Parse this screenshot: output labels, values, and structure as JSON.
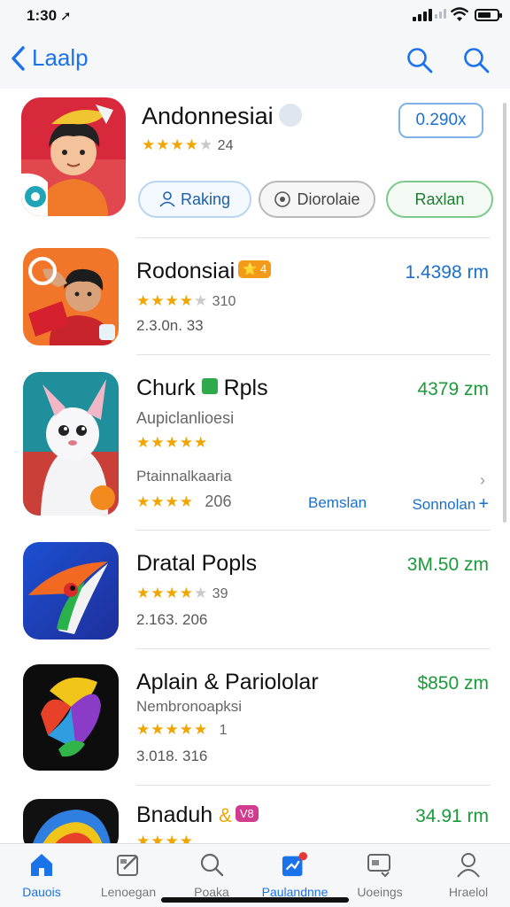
{
  "status_bar": {
    "time": "1:30",
    "location_glyph": "➚"
  },
  "nav": {
    "back_label": "Laalp"
  },
  "featured": {
    "title": "Andonnesiai",
    "rating_count": "24",
    "price": "0.290x",
    "buttons": [
      "Raking",
      "Diorolaie",
      "Raxlan"
    ]
  },
  "apps": [
    {
      "name": "Rodonsiai",
      "tag": "⭐ 4",
      "rating": "310",
      "meta": "2.3.0n. 33",
      "price": "1.4398 rm",
      "price_color": "blue"
    },
    {
      "name": "Chuɾk",
      "tag": "Rpls",
      "subtitle": "Aupiclanlioesi",
      "meta": "Ptainnalkaaria",
      "rating": "206",
      "action1": "Bemslan",
      "action2": "Sonnolan",
      "price": "4379 zm",
      "price_color": "green"
    },
    {
      "name": "Dratal Popls",
      "rating": "39",
      "meta": "2.163. 206",
      "price": "3M.50 zm",
      "price_color": "green"
    },
    {
      "name": "Aplain & Pariololar",
      "subtitle": "Nembronoapksi",
      "rating": "1",
      "meta": "3.018. 316",
      "price": "$850 zm",
      "price_color": "green"
    },
    {
      "name": "Bnaduh",
      "tag": "V8",
      "price": "34.91 rm",
      "price_color": "green"
    }
  ],
  "tabs": [
    "Dauois",
    "Lenoegan",
    "Poaka",
    "Paulandnne",
    "Uoeings",
    "Hraelol"
  ],
  "active_tab": "Paulandnne",
  "colors": {
    "accent": "#1a73e8",
    "green": "#1a9a3a",
    "star": "#f0a500"
  }
}
